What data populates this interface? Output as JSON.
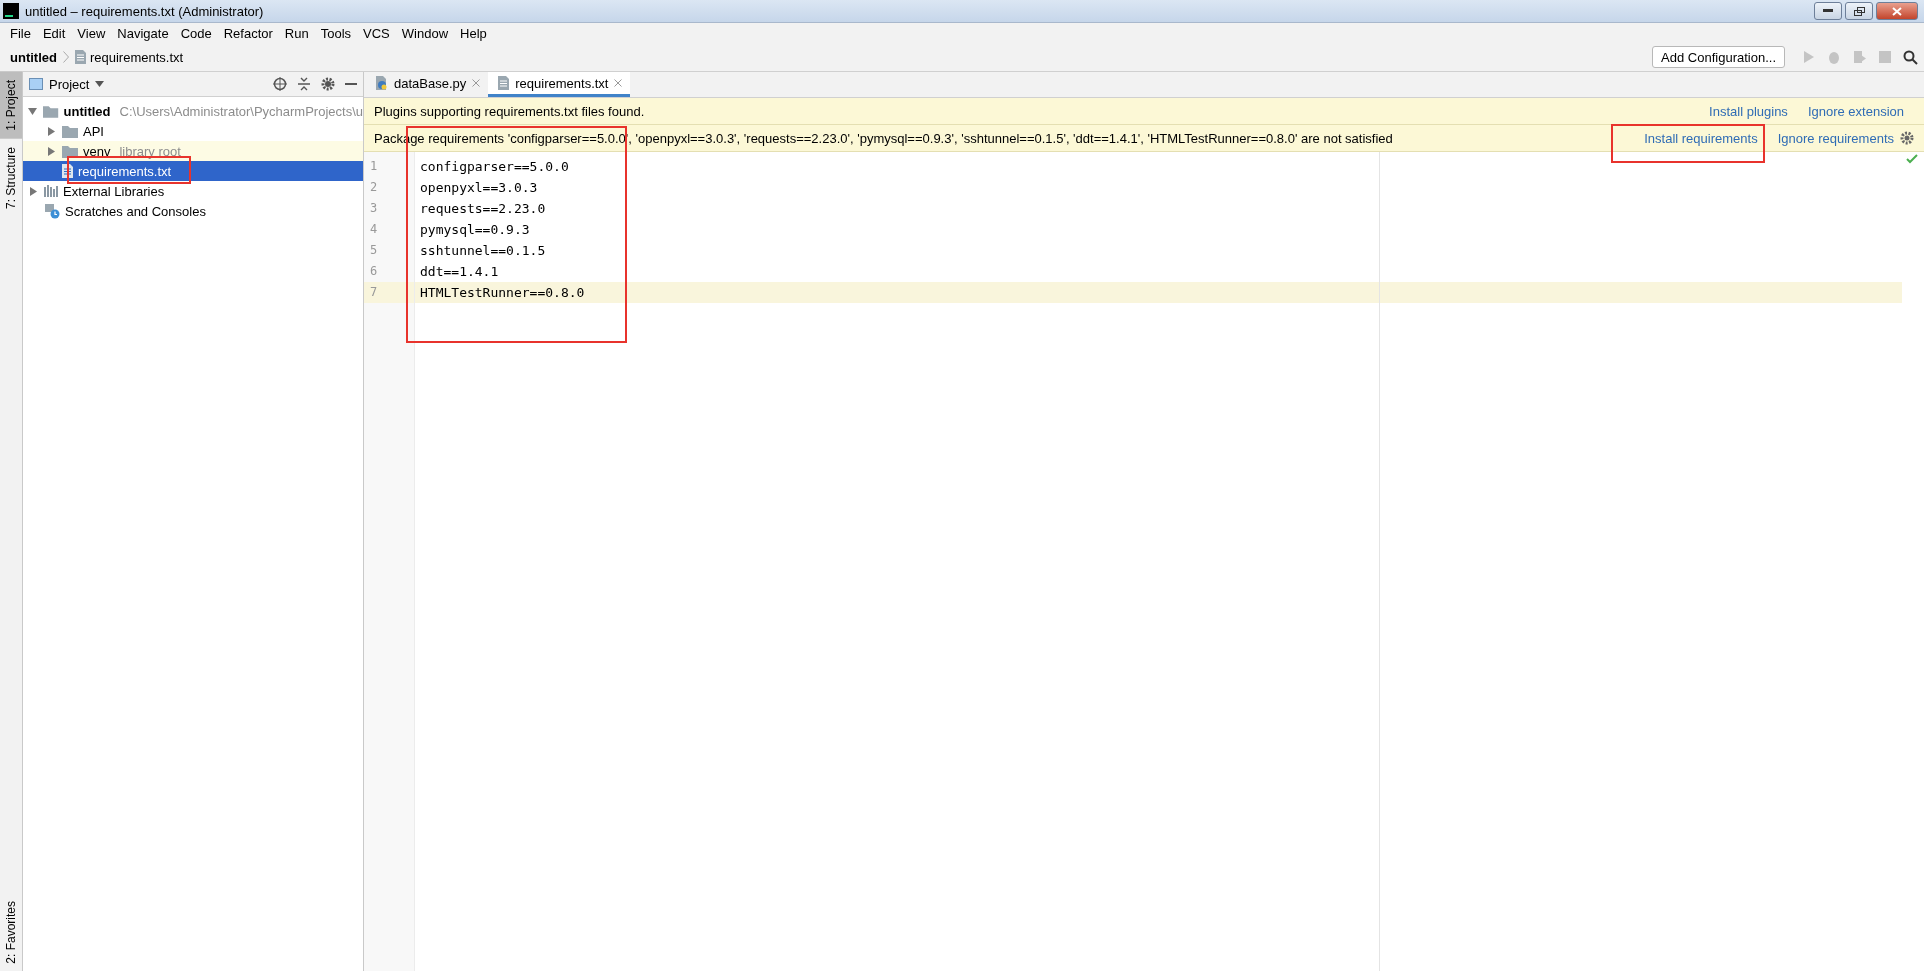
{
  "window": {
    "title": "untitled – requirements.txt (Administrator)"
  },
  "menu": [
    "File",
    "Edit",
    "View",
    "Navigate",
    "Code",
    "Refactor",
    "Run",
    "Tools",
    "VCS",
    "Window",
    "Help"
  ],
  "breadcrumb": [
    "untitled",
    "requirements.txt"
  ],
  "toolbar": {
    "run_configuration": "Add Configuration..."
  },
  "side_tools": [
    {
      "label": "1: Project",
      "selected": true
    },
    {
      "label": "7: Structure",
      "selected": false
    },
    {
      "label": "2: Favorites",
      "selected": false
    }
  ],
  "project_panel": {
    "title": "Project",
    "tree": [
      {
        "label": "untitled",
        "kind": "root",
        "hint": "C:\\Users\\Administrator\\PycharmProjects\\u",
        "expanded": true,
        "selected": false,
        "children": [
          {
            "label": "API",
            "kind": "folder",
            "expanded": false,
            "selected": false
          },
          {
            "label": "venv",
            "kind": "folder",
            "hint": "library root",
            "expanded": false,
            "selected": false
          },
          {
            "label": "requirements.txt",
            "kind": "file",
            "selected": true
          }
        ]
      },
      {
        "label": "External Libraries",
        "kind": "library",
        "expanded": false,
        "selected": false
      },
      {
        "label": "Scratches and Consoles",
        "kind": "scratches",
        "selected": false
      }
    ]
  },
  "tabs": [
    {
      "label": "dataBase.py",
      "kind": "python",
      "selected": false
    },
    {
      "label": "requirements.txt",
      "kind": "text",
      "selected": true
    }
  ],
  "banners": [
    {
      "message": "Plugins supporting requirements.txt files found.",
      "actions": [
        "Install plugins",
        "Ignore extension"
      ],
      "settings": false
    },
    {
      "message": "Package requirements 'configparser==5.0.0', 'openpyxl==3.0.3', 'requests==2.23.0', 'pymysql==0.9.3', 'sshtunnel==0.1.5', 'ddt==1.4.1', 'HTMLTestRunner==0.8.0' are not satisfied",
      "actions": [
        "Install requirements",
        "Ignore requirements"
      ],
      "settings": true
    }
  ],
  "editor": {
    "lines": [
      {
        "number": "1",
        "text": "configparser==5.0.0",
        "current": false
      },
      {
        "number": "2",
        "text": "openpyxl==3.0.3",
        "current": false
      },
      {
        "number": "3",
        "text": "requests==2.23.0",
        "current": false
      },
      {
        "number": "4",
        "text": "pymysql==0.9.3",
        "current": false
      },
      {
        "number": "5",
        "text": "sshtunnel==0.1.5",
        "current": false
      },
      {
        "number": "6",
        "text": "ddt==1.4.1",
        "current": false
      },
      {
        "number": "7",
        "text": "HTMLTestRunner==0.8.0",
        "current": true
      }
    ]
  }
}
